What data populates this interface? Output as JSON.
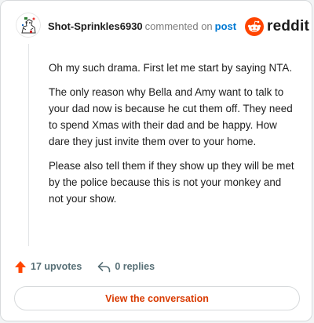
{
  "comment": {
    "author": "Shot-Sprinkles6930",
    "commented_on_text": "commented on",
    "post_link_text": "post",
    "paragraphs": [
      "Oh my such drama. First let me start by saying NTA.",
      "The only reason why Bella and Amy want to talk to your dad now is because he cut them off. They need to spend Xmas with their dad and be happy. How dare they just invite them over to your home.",
      "Please also tell them if they show up they will be met by the police because this is not your monkey and not your show."
    ]
  },
  "brand": {
    "name": "reddit",
    "icon": "reddit-snoo-icon",
    "color": "#ff4500"
  },
  "actions": {
    "upvotes_label": "17 upvotes",
    "upvote_icon": "upvote-arrow-icon",
    "replies_label": "0 replies",
    "reply_icon": "reply-arrow-icon"
  },
  "footer": {
    "view_conversation_label": "View the conversation"
  },
  "colors": {
    "upvote": "#ff4500",
    "link": "#0079d3",
    "cta_text": "#d93a00",
    "muted": "#576f76"
  }
}
